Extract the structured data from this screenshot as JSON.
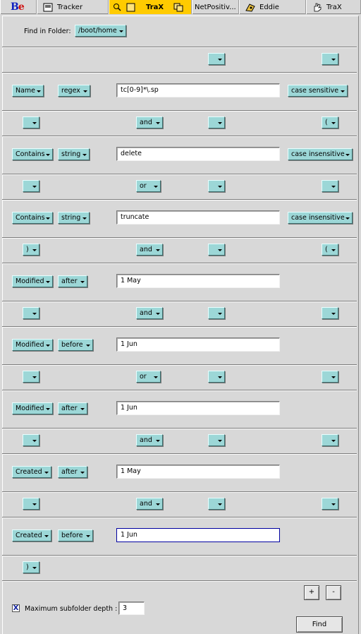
{
  "taskbar": {
    "tracker": "Tracker",
    "trax_active": "TraX",
    "netpositive": "NetPositiv...",
    "eddie": "Eddie",
    "trax": "TraX"
  },
  "find_in_folder": {
    "label": "Find in Folder:",
    "folder": "/boot/home"
  },
  "blank": "",
  "rows": {
    "c1": {
      "attribute": "Name",
      "operator": "regex",
      "value": "tc[0-9]*\\.sp",
      "case": "case sensitive"
    },
    "c2": {
      "attribute": "Contains",
      "operator": "string",
      "value": "delete",
      "case": "case insensitive"
    },
    "c3": {
      "attribute": "Contains",
      "operator": "string",
      "value": "truncate",
      "case": "case insensitive"
    },
    "c4": {
      "attribute": "Modified",
      "operator": "after",
      "value": "1 May"
    },
    "c5": {
      "attribute": "Modified",
      "operator": "before",
      "value": "1 Jun"
    },
    "c6": {
      "attribute": "Modified",
      "operator": "after",
      "value": "1 Jun"
    },
    "c7": {
      "attribute": "Created",
      "operator": "after",
      "value": "1 May"
    },
    "c8": {
      "attribute": "Created",
      "operator": "before",
      "value": "1 Jun"
    }
  },
  "logic": {
    "l1": {
      "open": "",
      "conj": "",
      "close": "",
      "paren": ""
    },
    "l2": {
      "open": "",
      "conj": "and",
      "close": "",
      "paren": "("
    },
    "l3": {
      "open": "",
      "conj": "or",
      "close": "",
      "paren": ""
    },
    "l4": {
      "open": ")",
      "conj": "and",
      "close": "",
      "paren": "("
    },
    "l5": {
      "open": "",
      "conj": "and",
      "close": "",
      "paren": ""
    },
    "l6": {
      "open": "",
      "conj": "or",
      "close": "",
      "paren": ""
    },
    "l7": {
      "open": "",
      "conj": "and",
      "close": "",
      "paren": ""
    },
    "l8": {
      "open": "",
      "conj": "and",
      "close": "",
      "paren": ""
    },
    "l9": {
      "open": ")"
    }
  },
  "footer": {
    "add": "+",
    "remove": "-",
    "max_depth_label": "Maximum subfolder depth :",
    "max_depth_checked": "X",
    "max_depth_value": "3",
    "find": "Find"
  },
  "colors": {
    "menu_button": "#9cd7d7",
    "active_tab": "#ffcb00",
    "background": "#d8d8d8"
  },
  "icons": [
    "be-logo",
    "tracker-icon",
    "trax-icon",
    "netpositive-icon",
    "eddie-icon",
    "trax-hand-icon"
  ]
}
